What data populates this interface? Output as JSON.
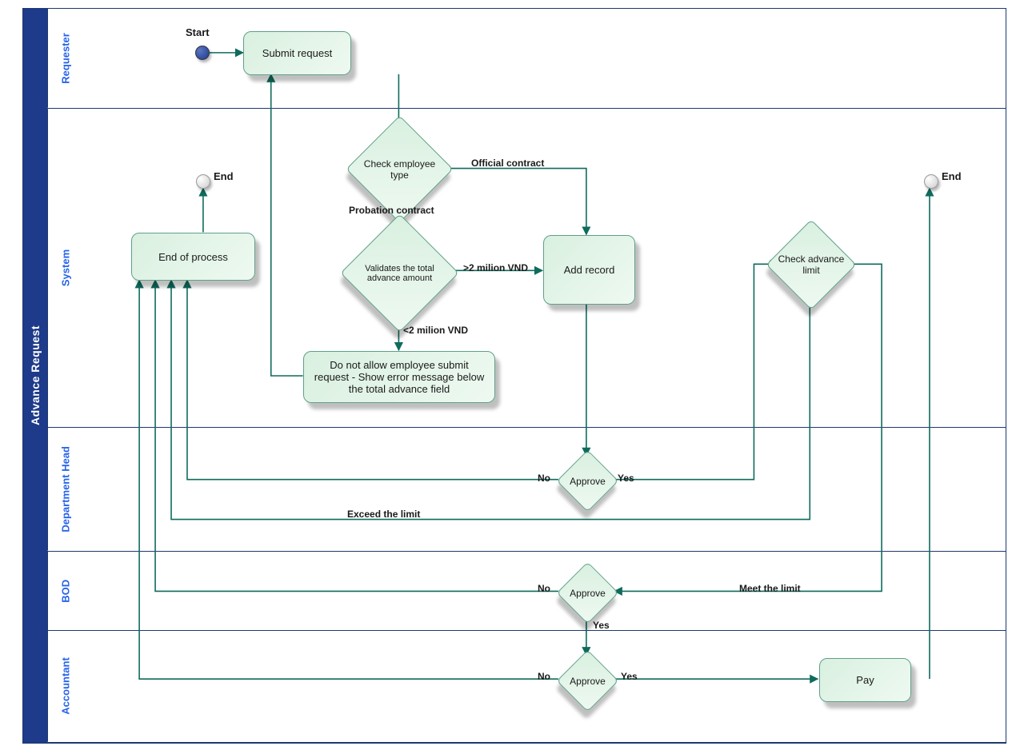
{
  "pool": {
    "title": "Advance Request"
  },
  "lanes": {
    "requester": "Requester",
    "system": "System",
    "dept": "Department Head",
    "bod": "BOD",
    "acct": "Accountant"
  },
  "events": {
    "start": "Start",
    "end1": "End",
    "end2": "End"
  },
  "tasks": {
    "submit": "Submit request",
    "check_type": "Check employee type",
    "validate_amount": "Validates the total advance amount",
    "not_allow": "Do not allow employee submit request - Show error message below the total advance field",
    "end_process": "End of process",
    "add_record": "Add record",
    "check_limit": "Check advance limit",
    "pay": "Pay"
  },
  "gateways": {
    "approve_dept": "Approve",
    "approve_bod": "Approve",
    "approve_acct": "Approve"
  },
  "edges": {
    "official": "Official contract",
    "probation": "Probation contract",
    "gt2m": ">2 milion VND",
    "lt2m": "<2 milion VND",
    "yes": "Yes",
    "no": "No",
    "exceed": "Exceed the limit",
    "meet": "Meet the limit"
  }
}
